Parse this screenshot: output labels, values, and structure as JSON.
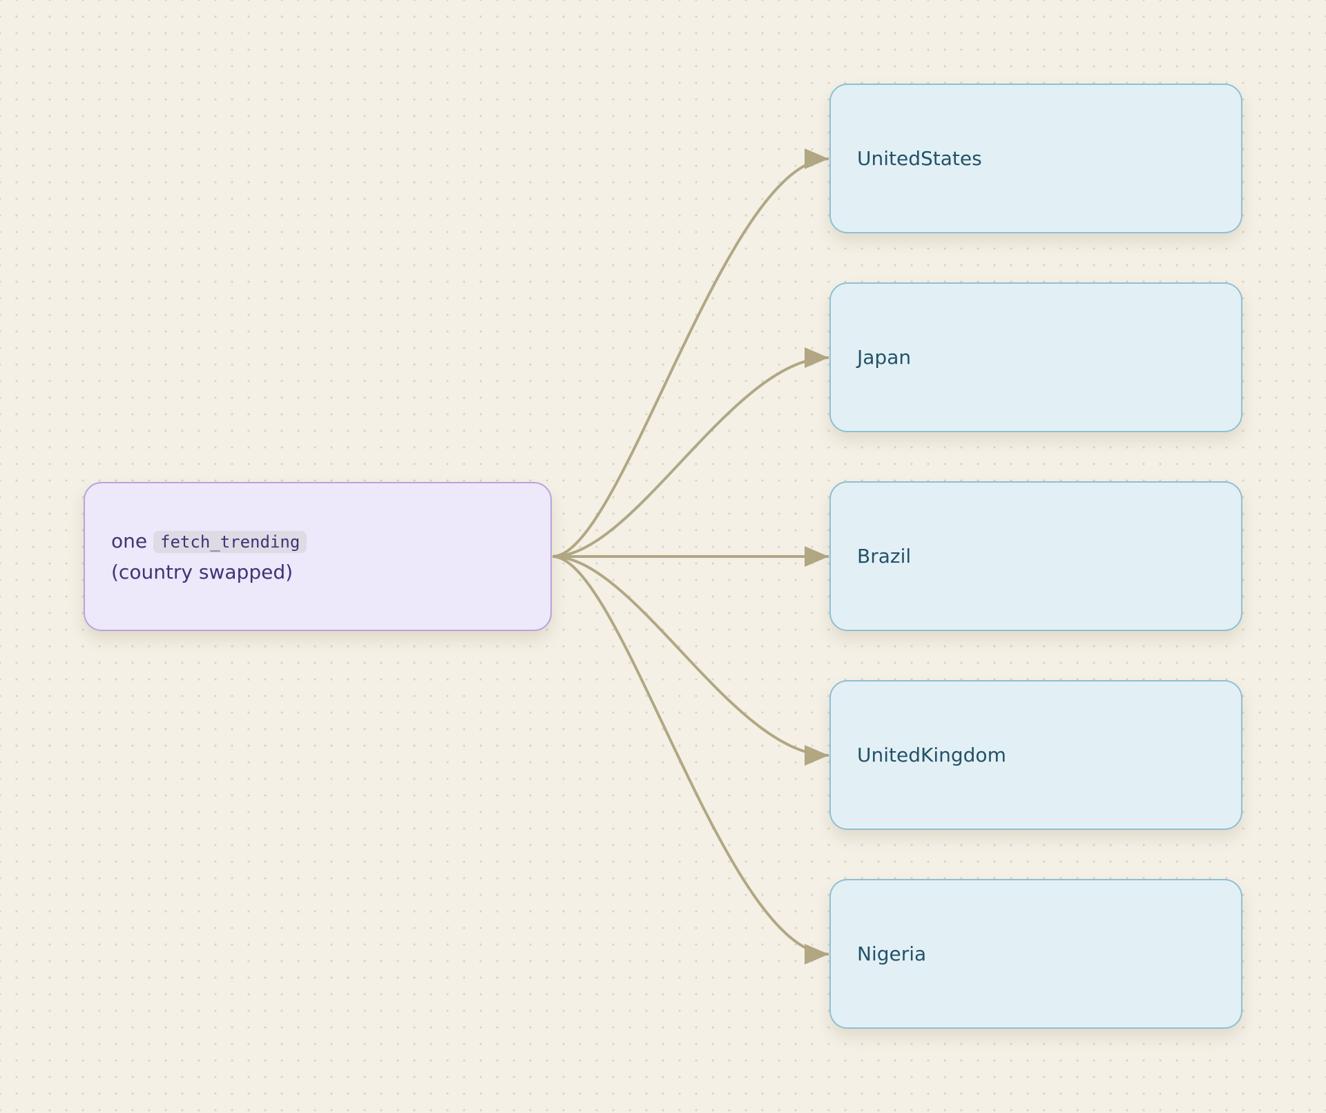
{
  "source": {
    "prefix": "one",
    "code": "fetch_trending",
    "suffix": "(country swapped)"
  },
  "targets": [
    {
      "label": "UnitedStates"
    },
    {
      "label": "Japan"
    },
    {
      "label": "Brazil"
    },
    {
      "label": "UnitedKingdom"
    },
    {
      "label": "Nigeria"
    }
  ],
  "edges": [
    {
      "from": "source",
      "to": "UnitedStates"
    },
    {
      "from": "source",
      "to": "Japan"
    },
    {
      "from": "source",
      "to": "Brazil"
    },
    {
      "from": "source",
      "to": "UnitedKingdom"
    },
    {
      "from": "source",
      "to": "Nigeria"
    }
  ],
  "colors": {
    "background": "#f4f0e6",
    "source_fill": "#ede8fa",
    "source_border": "#b8a3dc",
    "target_fill": "#e2f0f5",
    "target_border": "#8ebfd4",
    "edge": "#b1a783"
  }
}
